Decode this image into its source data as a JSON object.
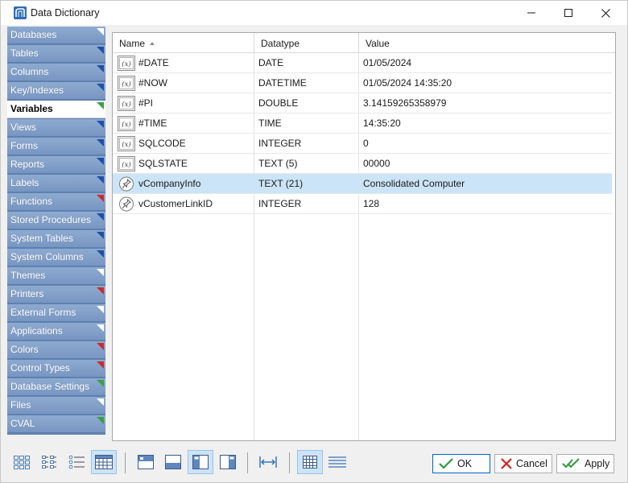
{
  "window": {
    "title": "Data Dictionary"
  },
  "sidebar": {
    "items": [
      {
        "label": "Databases",
        "marker": "#ffffff"
      },
      {
        "label": "Tables",
        "marker": "#1c4fa8"
      },
      {
        "label": "Columns",
        "marker": "#1c4fa8"
      },
      {
        "label": "Key/Indexes",
        "marker": "#1c4fa8"
      },
      {
        "label": "Variables",
        "marker": "#3aa040",
        "active": true
      },
      {
        "label": "Views",
        "marker": "#1c4fa8"
      },
      {
        "label": "Forms",
        "marker": "#1c4fa8"
      },
      {
        "label": "Reports",
        "marker": "#1c4fa8"
      },
      {
        "label": "Labels",
        "marker": "#1c4fa8"
      },
      {
        "label": "Functions",
        "marker": "#cc2a2a"
      },
      {
        "label": "Stored Procedures",
        "marker": "#1c4fa8"
      },
      {
        "label": "System Tables",
        "marker": "#1c4fa8"
      },
      {
        "label": "System Columns",
        "marker": "#1c4fa8"
      },
      {
        "label": "Themes",
        "marker": "#ffffff"
      },
      {
        "label": "Printers",
        "marker": "#cc2a2a"
      },
      {
        "label": "External Forms",
        "marker": "#ffffff"
      },
      {
        "label": "Applications",
        "marker": "#ffffff"
      },
      {
        "label": "Colors",
        "marker": "#cc2a2a"
      },
      {
        "label": "Control Types",
        "marker": "#cc2a2a"
      },
      {
        "label": "Database Settings",
        "marker": "#3aa040"
      },
      {
        "label": "Files",
        "marker": "#ffffff"
      },
      {
        "label": "CVAL",
        "marker": "#3aa040"
      }
    ]
  },
  "grid": {
    "columns": {
      "name": "Name",
      "datatype": "Datatype",
      "value": "Value"
    },
    "rows": [
      {
        "icon": "system-variable-icon",
        "name": "#DATE",
        "datatype": "DATE",
        "value": "01/05/2024"
      },
      {
        "icon": "system-variable-icon",
        "name": "#NOW",
        "datatype": "DATETIME",
        "value": "01/05/2024 14:35:20"
      },
      {
        "icon": "system-variable-icon",
        "name": "#PI",
        "datatype": "DOUBLE",
        "value": "3.14159265358979"
      },
      {
        "icon": "system-variable-icon",
        "name": "#TIME",
        "datatype": "TIME",
        "value": "14:35:20"
      },
      {
        "icon": "system-variable-icon",
        "name": "SQLCODE",
        "datatype": "INTEGER",
        "value": "0"
      },
      {
        "icon": "system-variable-icon",
        "name": "SQLSTATE",
        "datatype": "TEXT (5)",
        "value": "00000"
      },
      {
        "icon": "pin-icon",
        "name": "vCompanyInfo",
        "datatype": "TEXT (21)",
        "value": "Consolidated Computer",
        "selected": true
      },
      {
        "icon": "pin-icon",
        "name": "vCustomerLinkID",
        "datatype": "INTEGER",
        "value": "128"
      }
    ]
  },
  "buttons": {
    "ok": "OK",
    "cancel": "Cancel",
    "apply": "Apply"
  },
  "icon_glyph": "(x)",
  "colors": {
    "accent": "#0067c0",
    "sidebar": "#7896c2",
    "selected_row": "#cce4f7"
  }
}
